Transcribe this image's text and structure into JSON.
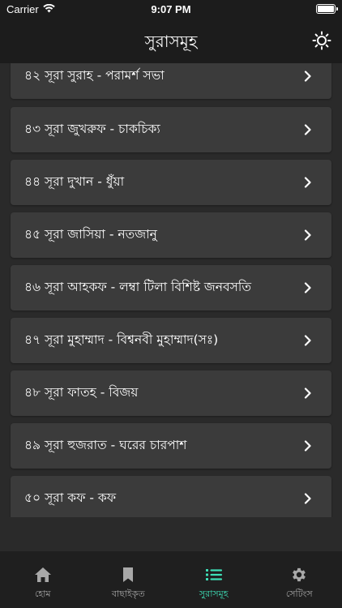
{
  "status": {
    "carrier": "Carrier",
    "time": "9:07 PM"
  },
  "nav": {
    "title": "সুরাসমূহ",
    "action_icon": "sun-icon"
  },
  "surahs": [
    {
      "label": "৪২ সূরা সুরাহ - পরামর্শ সভা"
    },
    {
      "label": "৪৩ সূরা জুখরুফ - চাকচিক্য"
    },
    {
      "label": "৪৪ সূরা দুখান - ধুঁয়া"
    },
    {
      "label": "৪৫ সূরা জাসিয়া - নতজানু"
    },
    {
      "label": "৪৬ সূরা আহকফ - লম্বা টিলা বিশিষ্ট জনবসতি"
    },
    {
      "label": "৪৭ সূরা মুহাম্মাদ - বিশ্বনবী মুহাম্মাদ(সঃ)"
    },
    {
      "label": "৪৮ সূরা ফাতহ - বিজয়"
    },
    {
      "label": "৪৯ সূরা হুজরাত - ঘরের চারপাশ"
    },
    {
      "label": "৫০ সূরা কফ - কফ"
    }
  ],
  "tabs": [
    {
      "label": "হোম",
      "icon": "home-icon"
    },
    {
      "label": "বাছাইকৃত",
      "icon": "bookmark-icon"
    },
    {
      "label": "সুরাসমূহ",
      "icon": "list-icon"
    },
    {
      "label": "সেটিংস",
      "icon": "gear-icon"
    }
  ],
  "colors": {
    "accent": "#3ee0b8",
    "row_background": "#3b3b3b",
    "page_background": "#2a2a2a",
    "bar_background": "#1c1c1c"
  }
}
